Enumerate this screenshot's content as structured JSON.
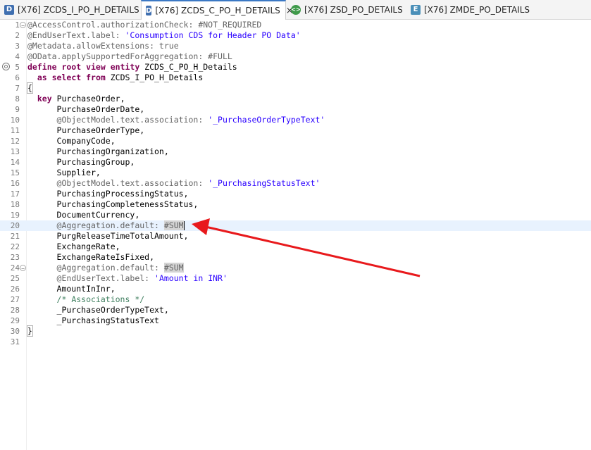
{
  "tabs": [
    {
      "icon": "D",
      "label": "[X76] ZCDS_I_PO_H_DETAILS"
    },
    {
      "icon": "D",
      "label": "[X76] ZCDS_C_PO_H_DETAILS"
    },
    {
      "icon": "<>",
      "label": "[X76] ZSD_PO_DETAILS"
    },
    {
      "icon": "E",
      "label": "[X76] ZMDE_PO_DETAILS"
    }
  ],
  "close_glyph": "×",
  "lines": [
    {
      "n": "1",
      "t": [
        [
          "ann",
          "@AccessControl.authorizationCheck: #NOT_REQUIRED"
        ]
      ]
    },
    {
      "n": "2",
      "t": [
        [
          "ann",
          "@EndUserText.label: "
        ],
        [
          "str",
          "'Consumption CDS for Header PO Data'"
        ]
      ]
    },
    {
      "n": "3",
      "t": [
        [
          "ann",
          "@Metadata.allowExtensions: true"
        ]
      ]
    },
    {
      "n": "4",
      "t": [
        [
          "ann",
          "@OData.applySupportedForAggregation: #FULL"
        ]
      ]
    },
    {
      "n": "5",
      "t": [
        [
          "kw",
          "define root view entity "
        ],
        [
          "id",
          "ZCDS_C_PO_H_Details"
        ]
      ]
    },
    {
      "n": "6",
      "t": [
        [
          "id",
          "  "
        ],
        [
          "kw",
          "as select from "
        ],
        [
          "id",
          "ZCDS_I_PO_H_Details"
        ]
      ]
    },
    {
      "n": "7",
      "t": [
        [
          "brace",
          "{"
        ]
      ]
    },
    {
      "n": "8",
      "t": [
        [
          "id",
          "  "
        ],
        [
          "kw",
          "key "
        ],
        [
          "id",
          "PurchaseOrder,"
        ]
      ]
    },
    {
      "n": "9",
      "t": [
        [
          "id",
          "      PurchaseOrderDate,"
        ]
      ]
    },
    {
      "n": "10",
      "t": [
        [
          "id",
          "      "
        ],
        [
          "ann",
          "@ObjectModel.text.association: "
        ],
        [
          "str",
          "'_PurchaseOrderTypeText'"
        ]
      ]
    },
    {
      "n": "11",
      "t": [
        [
          "id",
          "      PurchaseOrderType,"
        ]
      ]
    },
    {
      "n": "12",
      "t": [
        [
          "id",
          "      CompanyCode,"
        ]
      ]
    },
    {
      "n": "13",
      "t": [
        [
          "id",
          "      PurchasingOrganization,"
        ]
      ]
    },
    {
      "n": "14",
      "t": [
        [
          "id",
          "      PurchasingGroup,"
        ]
      ]
    },
    {
      "n": "15",
      "t": [
        [
          "id",
          "      Supplier,"
        ]
      ]
    },
    {
      "n": "16",
      "t": [
        [
          "id",
          "      "
        ],
        [
          "ann",
          "@ObjectModel.text.association: "
        ],
        [
          "str",
          "'_PurchasingStatusText'"
        ]
      ]
    },
    {
      "n": "17",
      "t": [
        [
          "id",
          "      PurchasingProcessingStatus,"
        ]
      ]
    },
    {
      "n": "18",
      "t": [
        [
          "id",
          "      PurchasingCompletenessStatus,"
        ]
      ]
    },
    {
      "n": "19",
      "t": [
        [
          "id",
          "      DocumentCurrency,"
        ]
      ]
    },
    {
      "n": "20",
      "t": [
        [
          "id",
          "      "
        ],
        [
          "ann",
          "@Aggregation.default: "
        ],
        [
          "ann hl",
          "#SUM"
        ],
        [
          "cursor",
          ""
        ]
      ]
    },
    {
      "n": "21",
      "t": [
        [
          "id",
          "      PurgReleaseTimeTotalAmount,"
        ]
      ]
    },
    {
      "n": "22",
      "t": [
        [
          "id",
          "      ExchangeRate,"
        ]
      ]
    },
    {
      "n": "23",
      "t": [
        [
          "id",
          "      ExchangeRateIsFixed,"
        ]
      ]
    },
    {
      "n": "24",
      "t": [
        [
          "id",
          "      "
        ],
        [
          "ann",
          "@Aggregation.default: "
        ],
        [
          "ann hl",
          "#SUM"
        ]
      ]
    },
    {
      "n": "25",
      "t": [
        [
          "id",
          "      "
        ],
        [
          "ann",
          "@EndUserText.label: "
        ],
        [
          "str",
          "'Amount in INR'"
        ]
      ]
    },
    {
      "n": "26",
      "t": [
        [
          "id",
          "      AmountInInr,"
        ]
      ]
    },
    {
      "n": "27",
      "t": [
        [
          "id",
          "      "
        ],
        [
          "cm",
          "/* Associations */"
        ]
      ]
    },
    {
      "n": "28",
      "t": [
        [
          "id",
          "      _PurchaseOrderTypeText,"
        ]
      ]
    },
    {
      "n": "29",
      "t": [
        [
          "id",
          "      _PurchasingStatusText"
        ]
      ]
    },
    {
      "n": "30",
      "t": [
        [
          "brace",
          "}"
        ]
      ]
    },
    {
      "n": "31",
      "t": []
    }
  ],
  "fold_lines": [
    "1",
    "24"
  ],
  "current_line": "20",
  "colors": {
    "annotation": "#646464",
    "keyword": "#7f0055",
    "string": "#2a00ff",
    "comment": "#3f7f5f",
    "arrow": "#e8191c",
    "current_line": "#e8f2fe"
  }
}
